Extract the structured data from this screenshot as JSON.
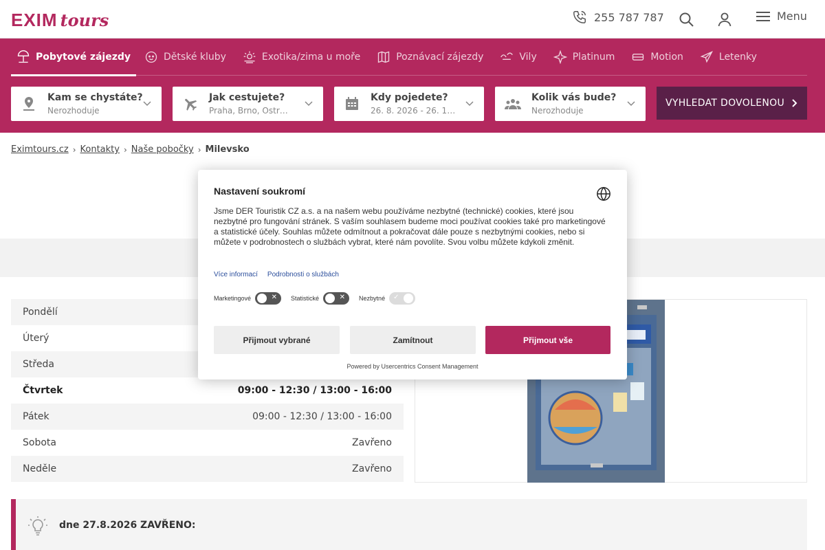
{
  "header": {
    "logo_main": "EXIM",
    "logo_script": "tours",
    "phone": "255 787 787",
    "menu_label": "Menu"
  },
  "categories": [
    {
      "label": "Pobytové zájezdy",
      "icon": "beach-umbrella-icon",
      "active": true
    },
    {
      "label": "Dětské kluby",
      "icon": "kids-club-icon"
    },
    {
      "label": "Exotika/zima u moře",
      "icon": "sun-icon"
    },
    {
      "label": "Poznávací zájezdy",
      "icon": "map-icon"
    },
    {
      "label": "Vily",
      "icon": "villa-icon"
    },
    {
      "label": "Platinum",
      "icon": "sparkle-icon"
    },
    {
      "label": "Motion",
      "icon": "motion-icon"
    },
    {
      "label": "Letenky",
      "icon": "plane-icon"
    }
  ],
  "search": {
    "where_title": "Kam se chystáte?",
    "where_value": "Nerozhoduje",
    "how_title": "Jak cestujete?",
    "how_value": "Praha, Brno, Ostr…",
    "when_title": "Kdy pojedete?",
    "when_value": "26. 8. 2026 - 26. 1…",
    "who_title": "Kolik vás bude?",
    "who_value": "Nerozhoduje",
    "button": "VYHLEDAT DOVOLENOU"
  },
  "breadcrumb": {
    "home": "Eximtours.cz",
    "contacts": "Kontakty",
    "branches": "Naše pobočky",
    "current": "Milevsko"
  },
  "hours": [
    {
      "day": "Pondělí",
      "time": ""
    },
    {
      "day": "Úterý",
      "time": ""
    },
    {
      "day": "Středa",
      "time": ""
    },
    {
      "day": "Čtvrtek",
      "time": "09:00 - 12:30 / 13:00 - 16:00"
    },
    {
      "day": "Pátek",
      "time": "09:00 - 12:30 / 13:00 - 16:00"
    },
    {
      "day": "Sobota",
      "time": "Zavřeno"
    },
    {
      "day": "Neděle",
      "time": "Zavřeno"
    }
  ],
  "notice": "dne 27.8.2026 ZAVŘENO:",
  "consent": {
    "title": "Nastavení soukromí",
    "body": "Jsme DER Touristik CZ a.s. a na našem webu používáme nezbytné (technické) cookies, které jsou nezbytné pro fungování stránek. S vaším souhlasem budeme moci používat cookies také pro marketingové a statistické účely. Souhlas můžete odmítnout a pokračovat dále pouze s nezbytnými cookies, nebo si můžete v podrobnostech o službách vybrat, které nám povolíte. Svou volbu můžete kdykoli změnit.",
    "link_more": "Více informací",
    "link_details": "Podrobnosti o službách",
    "toggle_marketing": "Marketingové",
    "toggle_stats": "Statistické",
    "toggle_necessary": "Nezbytné",
    "btn_selected": "Přijmout vybrané",
    "btn_reject": "Zamítnout",
    "btn_accept_all": "Přijmout vše",
    "powered": "Powered by Usercentrics Consent Management"
  },
  "colors": {
    "brand": "#b3285e",
    "search_button": "#5a2048"
  }
}
